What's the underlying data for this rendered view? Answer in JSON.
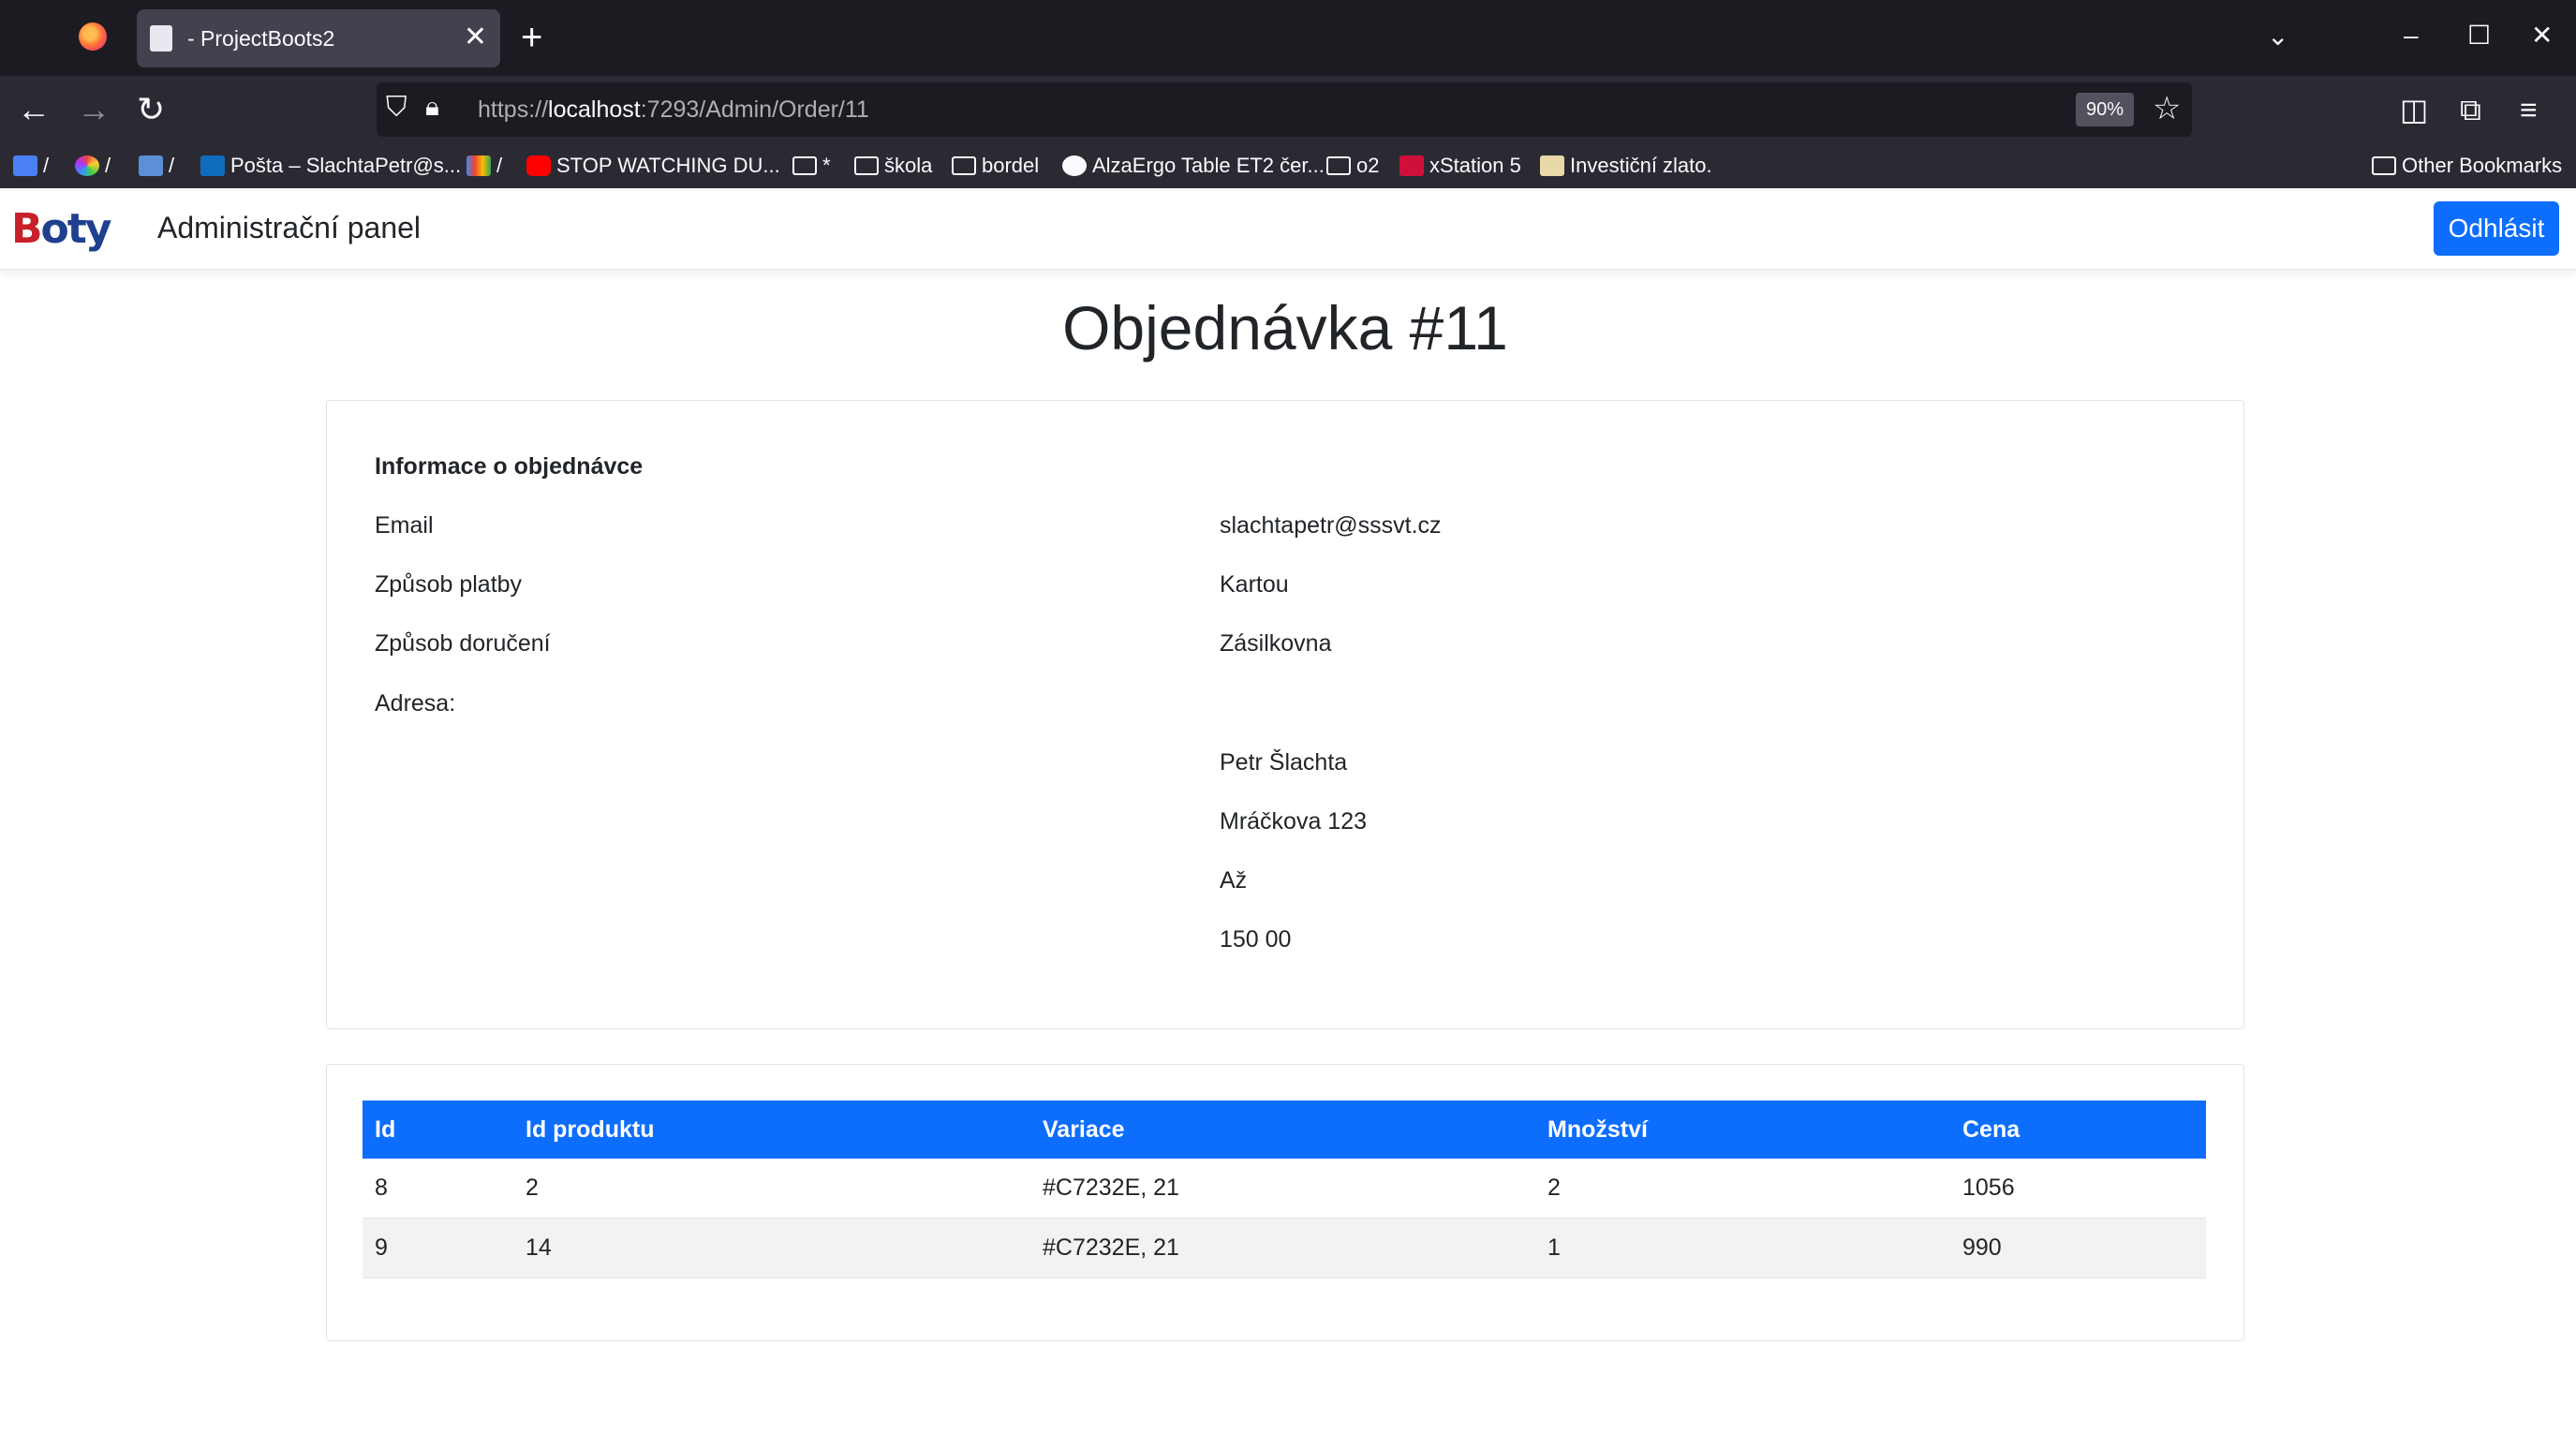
{
  "browser": {
    "tab_title": "- ProjectBoots2",
    "url_prefix": "https://",
    "url_host": "localhost",
    "url_rest": ":7293/Admin/Order/11",
    "zoom": "90%",
    "bookmarks": [
      {
        "label": "/",
        "icon": "translate-icon"
      },
      {
        "label": "/",
        "icon": "color-wheel-icon"
      },
      {
        "label": "/",
        "icon": "vs-icon"
      },
      {
        "label": "Pošta – SlachtaPetr@s...",
        "icon": "outlook-icon"
      },
      {
        "label": "/",
        "icon": "gmail-icon"
      },
      {
        "label": "STOP WATCHING DU...",
        "icon": "youtube-icon"
      },
      {
        "label": "*",
        "icon": "folder-icon"
      },
      {
        "label": "škola",
        "icon": "folder-icon"
      },
      {
        "label": "bordel",
        "icon": "folder-icon"
      },
      {
        "label": "AlzaErgo Table ET2 čer...",
        "icon": "alza-icon"
      },
      {
        "label": "o2",
        "icon": "folder-icon"
      },
      {
        "label": "xStation 5",
        "icon": "xtb-icon"
      },
      {
        "label": "Investiční zlato.",
        "icon": "gold-icon"
      }
    ],
    "other_bookmarks": "Other Bookmarks"
  },
  "nav": {
    "logo": "Boty",
    "title": "Administrační panel",
    "logout": "Odhlásit"
  },
  "page": {
    "title": "Objednávka #11"
  },
  "info": {
    "heading": "Informace o objednávce",
    "email_label": "Email",
    "email": "slachtapetr@sssvt.cz",
    "payment_label": "Způsob platby",
    "payment": "Kartou",
    "delivery_label": "Způsob doručení",
    "delivery": "Zásilkovna",
    "address_label": "Adresa:",
    "address_lines": [
      "Petr Šlachta",
      "Mráčkova 123",
      "Až",
      "150 00"
    ]
  },
  "items": {
    "headers": [
      "Id",
      "Id produktu",
      "Variace",
      "Množství",
      "Cena"
    ],
    "rows": [
      [
        "8",
        "2",
        "#C7232E, 21",
        "2",
        "1056"
      ],
      [
        "9",
        "14",
        "#C7232E, 21",
        "1",
        "990"
      ]
    ]
  },
  "colors": {
    "primary": "#0d6efd",
    "chrome_dark": "#1c1b22",
    "chrome_mid": "#2b2a33"
  }
}
